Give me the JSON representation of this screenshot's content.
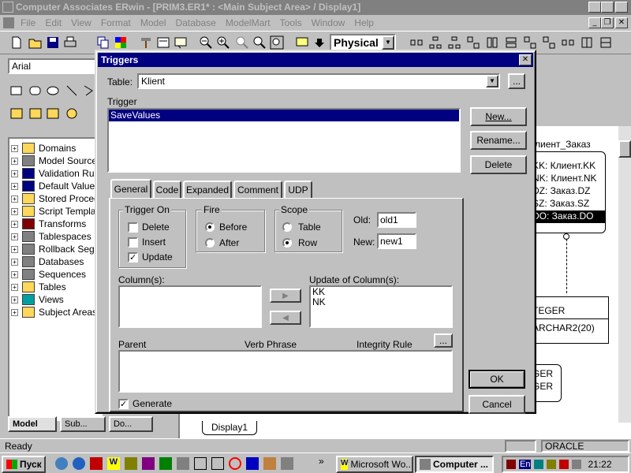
{
  "app": {
    "title": "Computer Associates ERwin - [PRIM3.ER1* : <Main Subject Area> / Display1]",
    "menu": [
      "File",
      "Edit",
      "View",
      "Format",
      "Model",
      "Database",
      "ModelMart",
      "Tools",
      "Window",
      "Help"
    ],
    "model_type": "Physical",
    "font_name": "Arial",
    "status_left": "Ready",
    "status_right": "ORACLE",
    "display_tab": "Display1"
  },
  "tree": {
    "items": [
      {
        "label": "Domains",
        "icon": "domains-icon"
      },
      {
        "label": "Model Sources",
        "icon": "model-sources-icon"
      },
      {
        "label": "Validation Rule",
        "icon": "validation-rule-icon"
      },
      {
        "label": "Default Values",
        "icon": "default-values-icon"
      },
      {
        "label": "Stored Proced",
        "icon": "stored-procedure-icon"
      },
      {
        "label": "Script Templat",
        "icon": "script-template-icon"
      },
      {
        "label": "Transforms",
        "icon": "transforms-icon"
      },
      {
        "label": "Tablespaces",
        "icon": "tablespaces-icon"
      },
      {
        "label": "Rollback Segn",
        "icon": "rollback-segment-icon"
      },
      {
        "label": "Databases",
        "icon": "databases-icon"
      },
      {
        "label": "Sequences",
        "icon": "sequences-icon"
      },
      {
        "label": "Tables",
        "icon": "tables-icon"
      },
      {
        "label": "Views",
        "icon": "views-icon"
      },
      {
        "label": "Subject Areas",
        "icon": "subject-areas-icon"
      }
    ],
    "tabs": [
      "Model",
      "Sub...",
      "Do..."
    ]
  },
  "diagram": {
    "entity_title": "лиент_Заказ",
    "entity_rows": [
      "KK: Клиент.KK",
      "NK: Клиент.NK",
      "DZ: Заказ.DZ",
      "SZ: Заказ.SZ",
      "DO: Заказ.DO"
    ],
    "entity2_rows": [
      "TEGER",
      "ARCHAR2(20)"
    ],
    "entity3_rows": [
      "GER",
      "GER"
    ]
  },
  "dialog": {
    "title": "Triggers",
    "table_label": "Table:",
    "table_value": "Klient",
    "trigger_label": "Trigger",
    "triggers": [
      "SaveValues"
    ],
    "buttons": {
      "new": "New...",
      "rename": "Rename...",
      "delete": "Delete",
      "ok": "OK",
      "cancel": "Cancel",
      "ellipsis": "..."
    },
    "tabs": [
      "General",
      "Code",
      "Expanded",
      "Comment",
      "UDP"
    ],
    "trigger_on": {
      "label": "Trigger On",
      "delete": "Delete",
      "insert": "Insert",
      "update": "Update"
    },
    "fire": {
      "label": "Fire",
      "before": "Before",
      "after": "After"
    },
    "scope": {
      "label": "Scope",
      "table": "Table",
      "row": "Row"
    },
    "old_label": "Old:",
    "old_value": "old1",
    "new_label": "New:",
    "new_value": "new1",
    "columns_label": "Column(s):",
    "update_columns_label": "Update of Column(s):",
    "update_columns": [
      "KK",
      "NK"
    ],
    "parent_label": "Parent",
    "verb_phrase_label": "Verb Phrase",
    "integrity_rule_label": "Integrity Rule",
    "generate_label": "Generate"
  },
  "taskbar": {
    "start": "Пуск",
    "tasks": [
      "Microsoft Wo...",
      "Computer ..."
    ],
    "lang": "En",
    "clock": "21:22"
  }
}
